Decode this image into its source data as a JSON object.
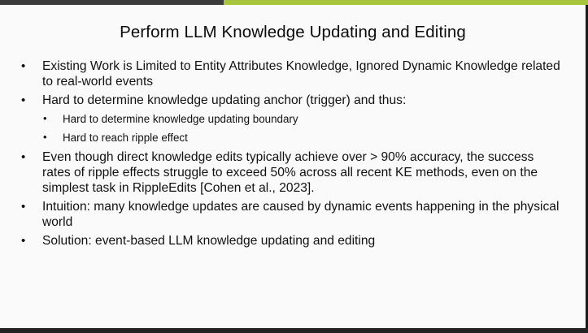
{
  "slide": {
    "title": "Perform LLM Knowledge Updating and Editing",
    "bullets": [
      {
        "text": "Existing Work is Limited to Entity Attributes Knowledge, Ignored Dynamic Knowledge related to real-world events"
      },
      {
        "text": "Hard to determine knowledge updating anchor (trigger) and thus:",
        "sub": [
          "Hard to determine knowledge updating boundary",
          "Hard to reach ripple effect"
        ]
      },
      {
        "text": "Even though direct knowledge edits typically achieve over > 90% accuracy, the success rates of ripple effects struggle to exceed 50% across all recent KE methods, even on the simplest task in RippleEdits [Cohen et al., 2023]."
      },
      {
        "text": "Intuition: many knowledge updates are caused by dynamic events happening in the physical world"
      },
      {
        "text": "Solution: event-based LLM knowledge updating and editing"
      }
    ],
    "bullet_glyph": "•"
  },
  "colors": {
    "accent": "#a7c43c",
    "dark_bar": "#3a3a3a",
    "background": "#fafafa"
  }
}
